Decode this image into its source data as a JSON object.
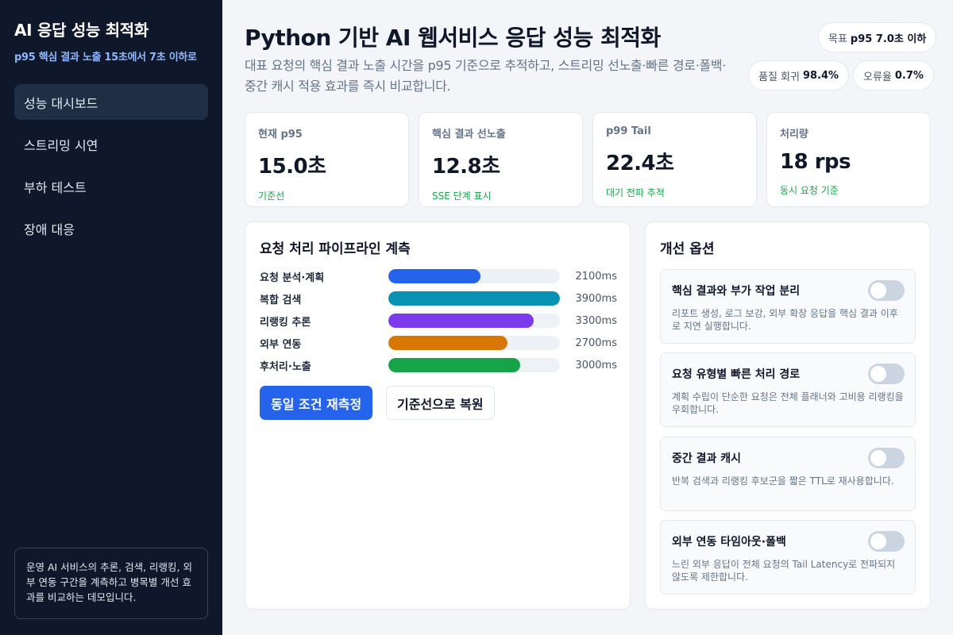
{
  "sidebar": {
    "title": "AI 응답 성능 최적화",
    "subtitle": "p95 핵심 결과 노출 15초에서 7초 이하로",
    "nav": [
      {
        "label": "성능 대시보드",
        "active": true
      },
      {
        "label": "스트리밍 시연",
        "active": false
      },
      {
        "label": "부하 테스트",
        "active": false
      },
      {
        "label": "장애 대응",
        "active": false
      }
    ],
    "note": "운영 AI 서비스의 추론, 검색, 리랭킹, 외부 연동 구간을 계측하고 병목별 개선 효과를 비교하는 데모입니다."
  },
  "header": {
    "title": "Python 기반 AI 웹서비스 응답 성능 최적화",
    "description": "대표 요청의 핵심 결과 노출 시간을 p95 기준으로 추적하고, 스트리밍 선노출·빠른 경로·폴백·중간 캐시 적용 효과를 즉시 비교합니다.",
    "target_label": "목표",
    "target_value": "p95 7.0초 이하",
    "quality_label": "품질 회귀",
    "quality_value": "98.4%",
    "error_label": "오류율",
    "error_value": "0.7%"
  },
  "kpis": [
    {
      "label": "현재 p95",
      "value": "15.0초",
      "note": "기준선"
    },
    {
      "label": "핵심 결과 선노출",
      "value": "12.8초",
      "note": "SSE 단계 표시"
    },
    {
      "label": "p99 Tail",
      "value": "22.4초",
      "note": "대기 전파 추적"
    },
    {
      "label": "처리량",
      "value": "18 rps",
      "note": "동시 요청 기준"
    }
  ],
  "pipeline": {
    "title": "요청 처리 파이프라인 계측",
    "max_ms": 3900,
    "stages": [
      {
        "label": "요청 분석·계획",
        "ms": 2100,
        "ms_label": "2100ms",
        "color": "#2563eb"
      },
      {
        "label": "복합 검색",
        "ms": 3900,
        "ms_label": "3900ms",
        "color": "#0891b2"
      },
      {
        "label": "리랭킹 추론",
        "ms": 3300,
        "ms_label": "3300ms",
        "color": "#7c3aed"
      },
      {
        "label": "외부 연동",
        "ms": 2700,
        "ms_label": "2700ms",
        "color": "#d97706"
      },
      {
        "label": "후처리·노출",
        "ms": 3000,
        "ms_label": "3000ms",
        "color": "#16a34a"
      }
    ],
    "remeasure_label": "동일 조건 재측정",
    "reset_label": "기준선으로 복원"
  },
  "options": {
    "title": "개선 옵션",
    "items": [
      {
        "title": "핵심 결과와 부가 작업 분리",
        "desc": "리포트 생성, 로그 보강, 외부 확장 응답을 핵심 결과 이후로 지연 실행합니다.",
        "enabled": false
      },
      {
        "title": "요청 유형별 빠른 처리 경로",
        "desc": "계획 수립이 단순한 요청은 전체 플래너와 고비용 리랭킹을 우회합니다.",
        "enabled": false
      },
      {
        "title": "중간 결과 캐시",
        "desc": "반복 검색과 리랭킹 후보군을 짧은 TTL로 재사용합니다.",
        "enabled": false
      },
      {
        "title": "외부 연동 타임아웃·폴백",
        "desc": "느린 외부 응답이 전체 요청의 Tail Latency로 전파되지 않도록 제한합니다.",
        "enabled": false
      }
    ]
  }
}
